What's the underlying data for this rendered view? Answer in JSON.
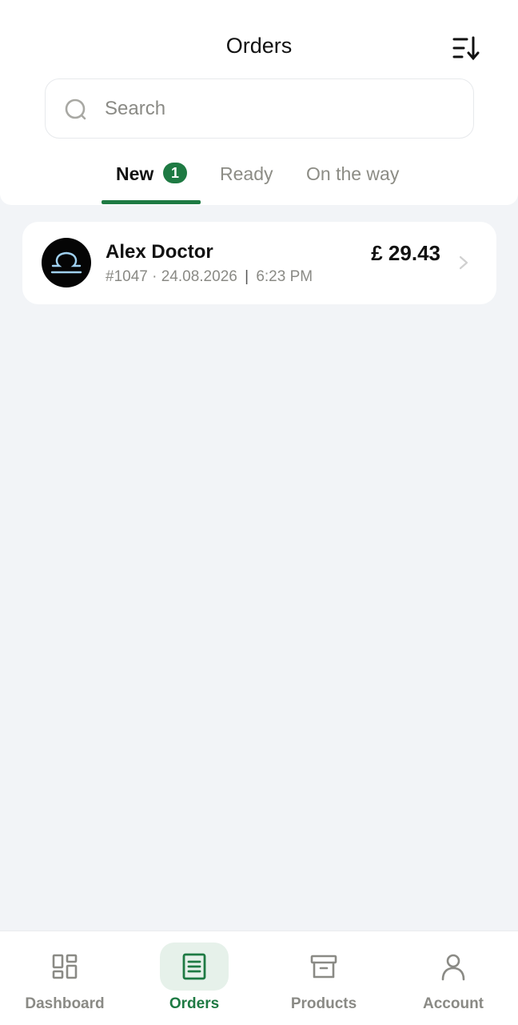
{
  "header": {
    "title": "Orders",
    "sort_icon": "sort-descending-icon"
  },
  "search": {
    "placeholder": "Search",
    "icon": "search-icon"
  },
  "tabs": [
    {
      "label": "New",
      "badge": "1",
      "active": true
    },
    {
      "label": "Ready",
      "active": false
    },
    {
      "label": "On the way",
      "active": false
    }
  ],
  "orders": [
    {
      "customer": "Alex Doctor",
      "order_id": "#1047",
      "date": "24.08.2026",
      "time": "6:23 PM",
      "price": "£ 29.43",
      "avatar_icon": "libra-icon"
    }
  ],
  "nav": [
    {
      "label": "Dashboard",
      "icon": "dashboard-icon",
      "active": false
    },
    {
      "label": "Orders",
      "icon": "orders-icon",
      "active": true
    },
    {
      "label": "Products",
      "icon": "archive-box-icon",
      "active": false
    },
    {
      "label": "Account",
      "icon": "user-icon",
      "active": false
    }
  ],
  "colors": {
    "accent": "#1e7a43",
    "background": "#f2f4f7",
    "muted_text": "#8a8a85"
  }
}
